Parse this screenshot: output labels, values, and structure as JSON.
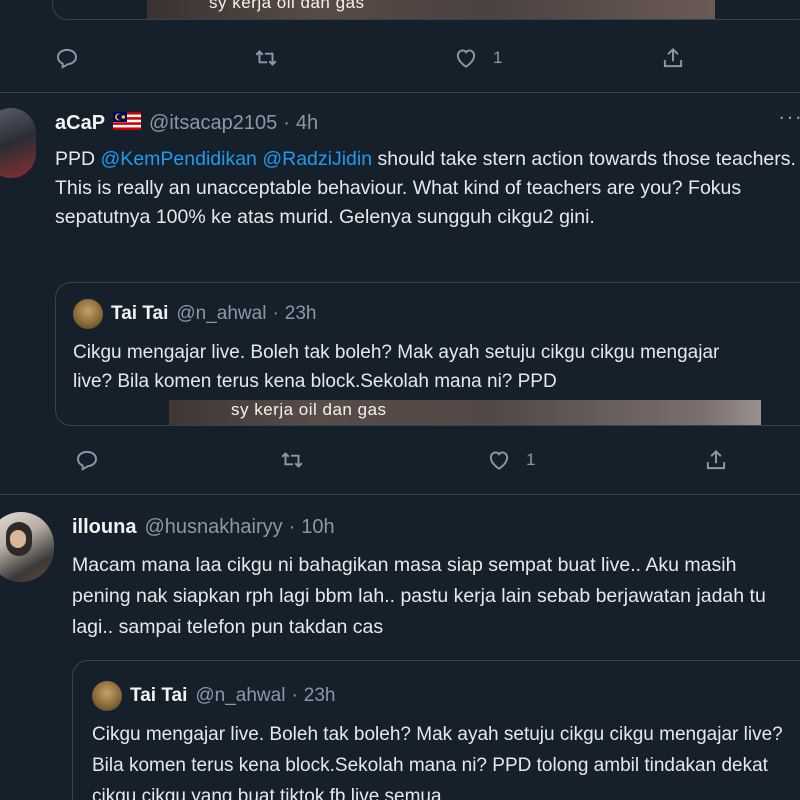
{
  "top_fragment": {
    "media_caption": "sy kerja oil dan gas",
    "actions": {
      "like_count": "1"
    }
  },
  "tweet1": {
    "display_name": "aCaP",
    "flag_name": "malaysia-flag-icon",
    "handle": "@itsacap2105",
    "time": "4h",
    "more_label": "···",
    "text_pre": "PPD ",
    "mention1": "@KemPendidikan",
    "mention2": "@RadziJidin",
    "text_post": " should take stern action towards those teachers. This is really an unacceptable behaviour. What kind of teachers are you? Fokus sepatutnya 100% ke atas murid. Gelenya sungguh cikgu2 gini.",
    "quote": {
      "display_name": "Tai Tai",
      "handle": "@n_ahwal",
      "time": "23h",
      "text": "Cikgu mengajar live. Boleh tak boleh? Mak ayah setuju cikgu cikgu mengajar live? Bila komen terus kena block.Sekolah mana ni? PPD",
      "media_caption": "sy kerja oil dan gas"
    },
    "actions": {
      "like_count": "1"
    }
  },
  "tweet2": {
    "display_name": "illouna",
    "handle": "@husnakhairyy",
    "time": "10h",
    "text": "Macam mana laa cikgu ni bahagikan masa siap sempat buat live.. Aku masih pening nak siapkan rph lagi bbm lah.. pastu kerja lain sebab berjawatan jadah tu lagi.. sampai telefon pun takdan cas",
    "quote": {
      "display_name": "Tai Tai",
      "handle": "@n_ahwal",
      "time": "23h",
      "text": "Cikgu mengajar live. Boleh tak boleh? Mak ayah setuju cikgu cikgu mengajar live? Bila komen terus kena block.Sekolah mana ni? PPD tolong ambil tindakan dekat cikgu cikgu yang buat tiktok fb live semua"
    }
  },
  "colors": {
    "background": "#15202b",
    "border": "#38444d",
    "muted": "#8b98a5",
    "link": "#1d9bf0"
  },
  "separator": "·"
}
